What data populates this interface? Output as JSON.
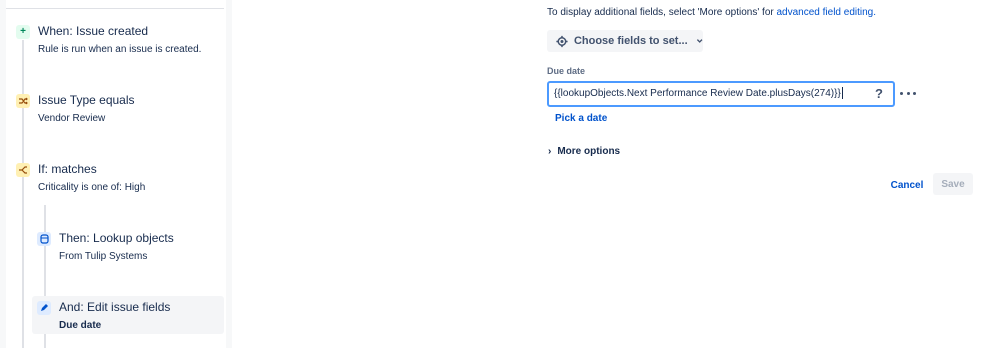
{
  "rule": {
    "trigger": {
      "icon": "plus-icon",
      "title": "When: Issue created",
      "subtitle": "Rule is run when an issue is created."
    },
    "condition": {
      "icon": "shuffle-icon",
      "title": "Issue Type equals",
      "subtitle": "Vendor Review"
    },
    "branch": {
      "icon": "branch-icon",
      "title": "If: matches",
      "subtitle": "Criticality is one of: High"
    },
    "lookup": {
      "icon": "database-icon",
      "title": "Then: Lookup objects",
      "subtitle": "From Tulip Systems"
    },
    "edit": {
      "icon": "pencil-icon",
      "title": "And: Edit issue fields",
      "subtitle": "Due date"
    }
  },
  "form": {
    "info_prefix": "To display additional fields, select 'More options' for ",
    "info_link": "advanced field editing.",
    "choose_fields_label": "Choose fields to set...",
    "due_date_label": "Due date",
    "due_date_value": "{{lookupObjects.Next Performance Review Date.plusDays(274)}}",
    "help_label": "?",
    "pick_date_label": "Pick a date",
    "more_options_label": "More options",
    "cancel_label": "Cancel",
    "save_label": "Save"
  },
  "colors": {
    "accent": "#0052cc",
    "focus_border": "#4c9aff",
    "trigger_icon": "#00875a",
    "condition_icon": "#974f0c"
  }
}
